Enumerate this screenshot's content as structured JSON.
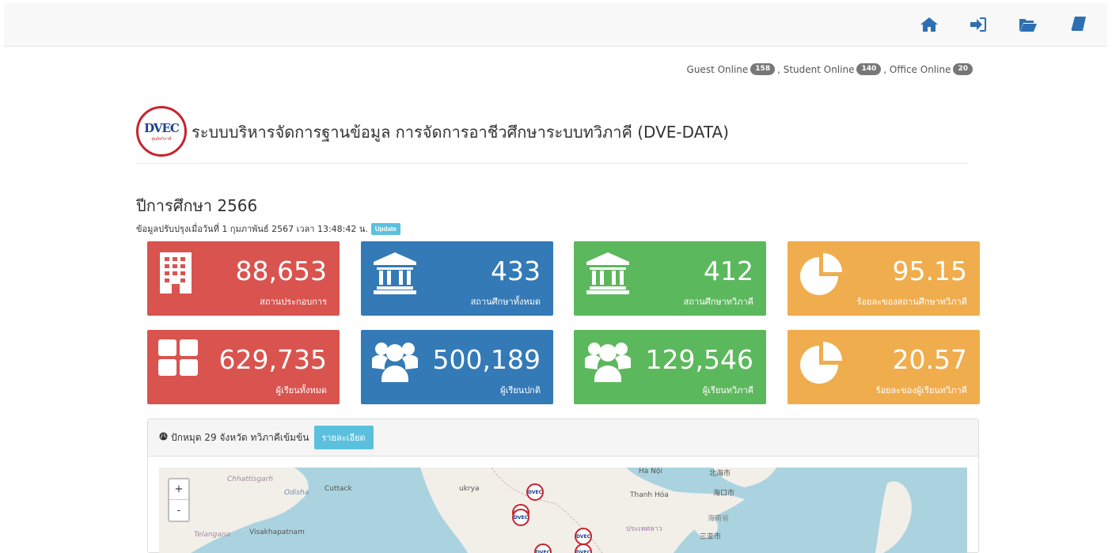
{
  "topnav": {
    "icons": [
      "home-icon",
      "sign-in-icon",
      "folder-open-icon",
      "book-icon"
    ]
  },
  "online": {
    "guest_label": "Guest Online",
    "guest_count": "158",
    "student_label": ", Student Online",
    "student_count": "140",
    "office_label": ", Office Online",
    "office_count": "20"
  },
  "header": {
    "logo_text": "DVEC",
    "logo_sub": "ศูนย์ทวิภาคี",
    "title": "ระบบบริหารจัดการฐานข้อมูล การจัดการอาชีวศึกษาระบบทวิภาคี (DVE-DATA)"
  },
  "summary": {
    "year_title": "ปีการศึกษา 2566",
    "updated_text": "ข้อมูลปรับปรุงเมื่อวันที่ 1 กุมภาพันธ์ 2567 เวลา 13:48:42 น.",
    "update_button": "Update"
  },
  "cards": [
    {
      "value": "88,653",
      "label": "สถานประกอบการ",
      "color": "#d9534f",
      "icon": "building-icon"
    },
    {
      "value": "433",
      "label": "สถานศึกษาทั้งหมด",
      "color": "#337ab7",
      "icon": "institution-icon"
    },
    {
      "value": "412",
      "label": "สถานศึกษาทวิภาคี",
      "color": "#5cb85c",
      "icon": "institution-icon"
    },
    {
      "value": "95.15",
      "label": "ร้อยละของสถานศึกษาทวิภาคี",
      "color": "#f0ad4e",
      "icon": "pie-chart-icon"
    },
    {
      "value": "629,735",
      "label": "ผู้เรียนทั้งหมด",
      "color": "#d9534f",
      "icon": "grid-icon"
    },
    {
      "value": "500,189",
      "label": "ผู้เรียนปกติ",
      "color": "#337ab7",
      "icon": "users-icon"
    },
    {
      "value": "129,546",
      "label": "ผู้เรียนทวิภาคี",
      "color": "#5cb85c",
      "icon": "users-icon"
    },
    {
      "value": "20.57",
      "label": "ร้อยละของผู้เรียนทวิภาคี",
      "color": "#f0ad4e",
      "icon": "pie-chart-icon"
    }
  ],
  "panel": {
    "heading": "ปักหมุด 29 จังหวัด ทวิภาคีเข้มข้น",
    "detail_button": "รายละเอียด"
  },
  "map": {
    "zoom_in": "+",
    "zoom_out": "-",
    "labels": [
      "Chhattisgarh",
      "Odisha",
      "Cuttack",
      "Visakhapatnam",
      "Telangana",
      "Hà Nội",
      "北海市",
      "Thanh Hóa",
      "海口市",
      "海南省",
      "三亚市",
      "ukrya",
      "ประเทศลาว"
    ],
    "marker_text": "DVEC"
  }
}
